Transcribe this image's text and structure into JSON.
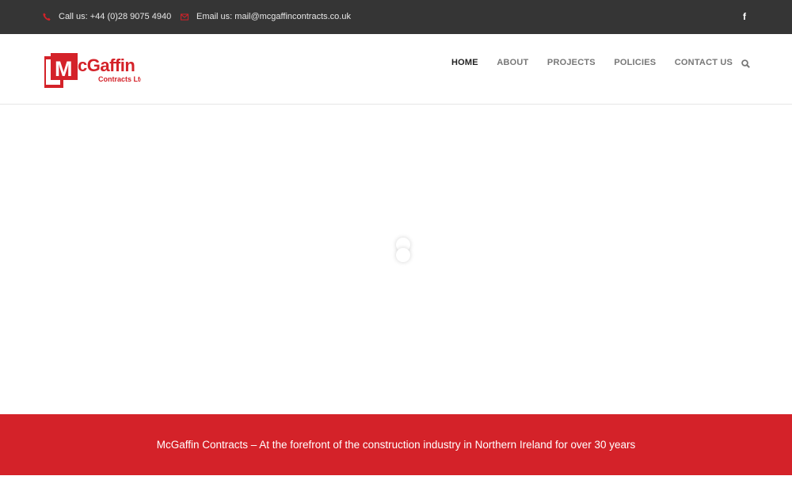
{
  "topbar": {
    "phone": {
      "icon": "phone-icon",
      "text": "Call us: +44 (0)28 9075 4940"
    },
    "email": {
      "icon": "envelope-icon",
      "text": "Email us: mail@mcgaffincontracts.co.uk"
    },
    "social": {
      "icon": "facebook-icon",
      "glyph": "f"
    }
  },
  "header": {
    "logo": {
      "main": "McGaffin",
      "sub": "Contracts Ltd"
    },
    "nav": {
      "items": [
        "HOME",
        "ABOUT",
        "PROJECTS",
        "POLICIES",
        "CONTACT US"
      ],
      "active": "HOME",
      "search_icon": "search-icon"
    }
  },
  "hero": {
    "loader_icon": "loading-spinner-icon"
  },
  "banner": {
    "text": "McGaffin Contracts – At the forefront of the construction industry in Northern Ireland for over 30 years"
  },
  "colors": {
    "topbar_bg": "#353535",
    "accent_red": "#d42229",
    "nav_text": "#777777",
    "nav_active": "#222222"
  }
}
